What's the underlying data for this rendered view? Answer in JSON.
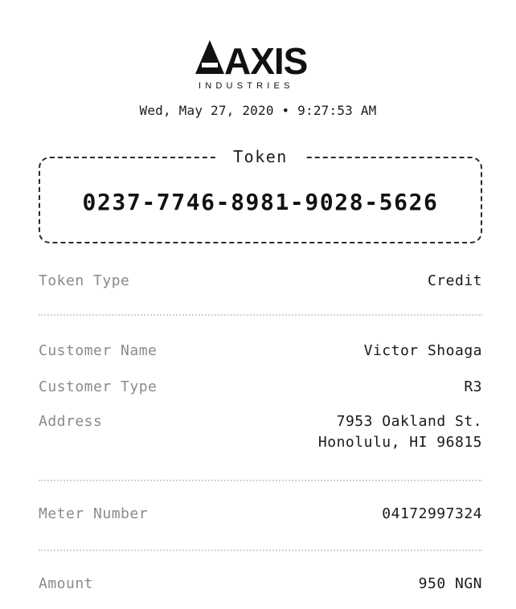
{
  "header": {
    "logo_main": "AXIS",
    "logo_sub": "INDUSTRIES",
    "datetime": "Wed, May 27, 2020 • 9:27:53 AM"
  },
  "token": {
    "label": "Token",
    "value": "0237-7746-8981-9028-5626"
  },
  "details": {
    "token_type": {
      "label": "Token Type",
      "value": "Credit"
    },
    "customer_name": {
      "label": "Customer Name",
      "value": "Victor Shoaga"
    },
    "customer_type": {
      "label": "Customer Type",
      "value": "R3"
    },
    "address": {
      "label": "Address",
      "line1": "7953 Oakland St.",
      "line2": "Honolulu, HI 96815"
    },
    "meter_number": {
      "label": "Meter Number",
      "value": "04172997324"
    },
    "amount": {
      "label": "Amount",
      "value": "950 NGN"
    }
  }
}
